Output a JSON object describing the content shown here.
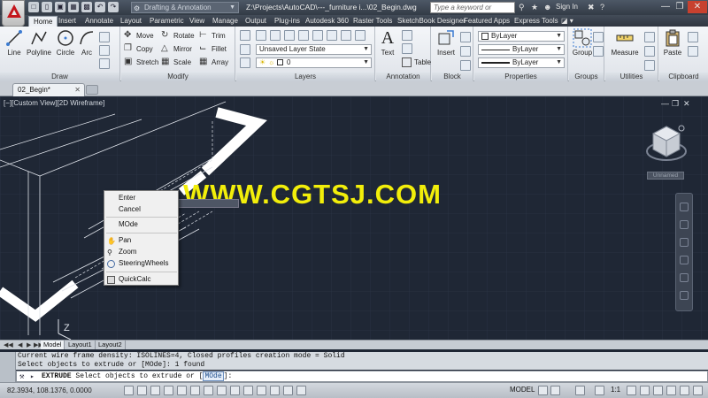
{
  "titlebar": {
    "workspace": "Drafting & Annotation",
    "window_title": "Z:\\Projects\\AutoCAD\\---_furniture i...\\02_Begin.dwg",
    "search_placeholder": "Type a keyword or phrase",
    "sign_in": "Sign In"
  },
  "ribbon_tabs": [
    "Home",
    "Insert",
    "Annotate",
    "Layout",
    "Parametric",
    "View",
    "Manage",
    "Output",
    "Plug-ins",
    "Autodesk 360",
    "Raster Tools",
    "SketchBook Designer",
    "Featured Apps",
    "Express Tools"
  ],
  "ribbon": {
    "draw": {
      "title": "Draw",
      "line": "Line",
      "polyline": "Polyline",
      "circle": "Circle",
      "arc": "Arc"
    },
    "modify": {
      "title": "Modify",
      "move": "Move",
      "rotate": "Rotate",
      "trim": "Trim",
      "copy": "Copy",
      "mirror": "Mirror",
      "fillet": "Fillet",
      "stretch": "Stretch",
      "scale": "Scale",
      "array": "Array"
    },
    "layers": {
      "title": "Layers",
      "layer_state": "Unsaved Layer State",
      "current_layer": "0"
    },
    "annotation": {
      "title": "Annotation",
      "text": "Text",
      "table": "Table"
    },
    "block": {
      "title": "Block",
      "insert": "Insert"
    },
    "properties": {
      "title": "Properties",
      "color": "ByLayer",
      "linetype": "ByLayer",
      "lineweight": "ByLayer"
    },
    "groups": {
      "title": "Groups",
      "group": "Group"
    },
    "utilities": {
      "title": "Utilities",
      "measure": "Measure"
    },
    "clipboard": {
      "title": "Clipboard",
      "paste": "Paste"
    }
  },
  "document_tab": "02_Begin*",
  "viewport": {
    "label": "[−][Custom View][2D Wireframe]",
    "viewcube_label": "Unnamed",
    "watermark": "WWW.CGTSJ.COM",
    "axis_label": "Z"
  },
  "context_menu": {
    "items": [
      "Enter",
      "Cancel",
      "MOde",
      "Pan",
      "Zoom",
      "SteeringWheels",
      "QuickCalc"
    ]
  },
  "layout_tabs": [
    "Model",
    "Layout1",
    "Layout2"
  ],
  "command": {
    "history": [
      "Current wire frame density:  ISOLINES=4, Closed profiles creation mode = Solid",
      "Select objects to extrude or [MOde]: 1 found"
    ],
    "prompt_name": "EXTRUDE",
    "prompt_text": "Select objects to extrude or [",
    "prompt_option": "MOde",
    "prompt_end": "]:"
  },
  "status": {
    "coordinates": "82.3934, 108.1376, 0.0000",
    "space": "MODEL",
    "scale": "1:1"
  },
  "colors": {
    "viewport_bg": "#1f2735",
    "watermark": "#f2ee0a",
    "accent_red": "#c4161c"
  }
}
